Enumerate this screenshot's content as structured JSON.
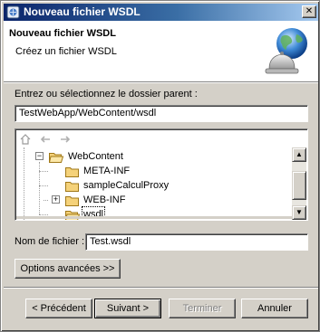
{
  "window": {
    "title": "Nouveau fichier WSDL",
    "close_glyph": "✕"
  },
  "banner": {
    "title": "Nouveau fichier WSDL",
    "description": "Créez un fichier WSDL",
    "icon": "globe-bell-icon"
  },
  "parent_folder": {
    "label": "Entrez ou sélectionnez le dossier parent :",
    "value": "TestWebApp/WebContent/wsdl"
  },
  "tree": {
    "toolbar": [
      "home-icon",
      "back-arrow-icon",
      "forward-arrow-icon"
    ],
    "items": [
      {
        "label": "WebContent",
        "expander": "−"
      },
      {
        "label": "META-INF",
        "expander": ""
      },
      {
        "label": "sampleCalculProxy",
        "expander": ""
      },
      {
        "label": "WEB-INF",
        "expander": "+"
      },
      {
        "label": "wsdl",
        "expander": "",
        "selected": true
      }
    ]
  },
  "filename": {
    "label": "Nom de fichier :",
    "value": "Test.wsdl"
  },
  "advanced_button": "Options avancées >>",
  "buttons": {
    "back": "< Précédent",
    "next": "Suivant >",
    "finish": "Terminer",
    "cancel": "Annuler"
  }
}
